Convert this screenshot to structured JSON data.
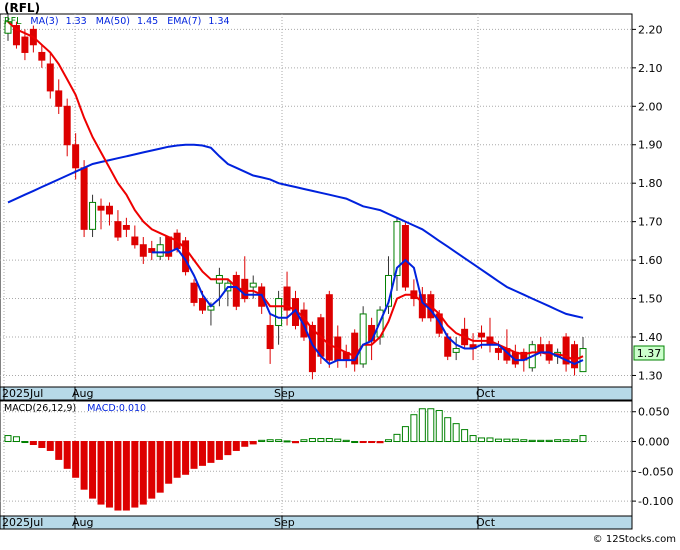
{
  "header": {
    "title": "(RFL)"
  },
  "main_chart": {
    "legend": {
      "ticker": "RFL",
      "ma3_label": "MA(3)",
      "ma3_value": "1.33",
      "ma50_label": "MA(50)",
      "ma50_value": "1.45",
      "ema7_label": "EMA(7)",
      "ema7_value": "1.34"
    },
    "y_ticks": [
      "2.20",
      "2.10",
      "2.00",
      "1.90",
      "1.80",
      "1.70",
      "1.60",
      "1.50",
      "1.40",
      "1.30"
    ],
    "last_price": "1.37"
  },
  "time_axis": {
    "labels": [
      "2025Jul",
      "Aug",
      "Sep",
      "Oct"
    ]
  },
  "macd_chart": {
    "legend": {
      "label": "MACD(26,12,9)",
      "macd_label": "MACD:",
      "macd_value": "0.010"
    },
    "y_ticks": [
      "0.050",
      "0.000",
      "-0.050",
      "-0.100"
    ]
  },
  "footer": {
    "credit": "© 12Stocks.com"
  },
  "colors": {
    "up": "#008000",
    "down": "#dd0000",
    "ma": "#0022dd",
    "ema": "#ee0000",
    "axis_band": "#b7d9e8"
  },
  "chart_data": [
    {
      "type": "candlestick",
      "title": "(RFL)",
      "ylim": [
        1.27,
        2.24
      ],
      "y_ticks": [
        2.2,
        2.1,
        2.0,
        1.9,
        1.8,
        1.7,
        1.6,
        1.5,
        1.4,
        1.3
      ],
      "x_labels": [
        "2025Jul",
        "Aug",
        "Sep",
        "Oct"
      ],
      "ohlc": [
        [
          2.19,
          2.24,
          2.17,
          2.22
        ],
        [
          2.21,
          2.22,
          2.15,
          2.16
        ],
        [
          2.18,
          2.2,
          2.12,
          2.14
        ],
        [
          2.2,
          2.21,
          2.14,
          2.16
        ],
        [
          2.14,
          2.16,
          2.1,
          2.12
        ],
        [
          2.11,
          2.14,
          2.02,
          2.04
        ],
        [
          2.04,
          2.07,
          1.98,
          2.0
        ],
        [
          2.0,
          2.02,
          1.87,
          1.9
        ],
        [
          1.9,
          1.93,
          1.81,
          1.84
        ],
        [
          1.84,
          1.86,
          1.66,
          1.68
        ],
        [
          1.68,
          1.77,
          1.66,
          1.75
        ],
        [
          1.74,
          1.76,
          1.68,
          1.73
        ],
        [
          1.74,
          1.75,
          1.69,
          1.72
        ],
        [
          1.7,
          1.73,
          1.65,
          1.66
        ],
        [
          1.69,
          1.71,
          1.66,
          1.68
        ],
        [
          1.66,
          1.69,
          1.63,
          1.64
        ],
        [
          1.64,
          1.66,
          1.59,
          1.61
        ],
        [
          1.63,
          1.65,
          1.6,
          1.62
        ],
        [
          1.61,
          1.66,
          1.6,
          1.64
        ],
        [
          1.66,
          1.66,
          1.6,
          1.61
        ],
        [
          1.67,
          1.68,
          1.62,
          1.63
        ],
        [
          1.65,
          1.66,
          1.56,
          1.57
        ],
        [
          1.54,
          1.55,
          1.48,
          1.49
        ],
        [
          1.5,
          1.52,
          1.46,
          1.47
        ],
        [
          1.47,
          1.49,
          1.43,
          1.48
        ],
        [
          1.54,
          1.58,
          1.48,
          1.56
        ],
        [
          1.52,
          1.55,
          1.48,
          1.54
        ],
        [
          1.56,
          1.57,
          1.47,
          1.48
        ],
        [
          1.55,
          1.61,
          1.49,
          1.5
        ],
        [
          1.53,
          1.56,
          1.5,
          1.54
        ],
        [
          1.53,
          1.54,
          1.46,
          1.48
        ],
        [
          1.43,
          1.46,
          1.33,
          1.37
        ],
        [
          1.43,
          1.52,
          1.38,
          1.5
        ],
        [
          1.53,
          1.57,
          1.43,
          1.47
        ],
        [
          1.5,
          1.52,
          1.42,
          1.43
        ],
        [
          1.47,
          1.49,
          1.39,
          1.4
        ],
        [
          1.43,
          1.44,
          1.29,
          1.31
        ],
        [
          1.45,
          1.46,
          1.33,
          1.35
        ],
        [
          1.51,
          1.52,
          1.32,
          1.34
        ],
        [
          1.4,
          1.43,
          1.32,
          1.34
        ],
        [
          1.36,
          1.38,
          1.32,
          1.34
        ],
        [
          1.41,
          1.42,
          1.31,
          1.33
        ],
        [
          1.33,
          1.48,
          1.32,
          1.46
        ],
        [
          1.43,
          1.45,
          1.34,
          1.39
        ],
        [
          1.4,
          1.48,
          1.38,
          1.47
        ],
        [
          1.48,
          1.61,
          1.46,
          1.56
        ],
        [
          1.56,
          1.71,
          1.52,
          1.7
        ],
        [
          1.69,
          1.7,
          1.52,
          1.53
        ],
        [
          1.52,
          1.55,
          1.48,
          1.5
        ],
        [
          1.51,
          1.53,
          1.44,
          1.45
        ],
        [
          1.51,
          1.52,
          1.44,
          1.45
        ],
        [
          1.46,
          1.47,
          1.4,
          1.41
        ],
        [
          1.4,
          1.41,
          1.34,
          1.35
        ],
        [
          1.36,
          1.4,
          1.34,
          1.37
        ],
        [
          1.42,
          1.45,
          1.37,
          1.38
        ],
        [
          1.38,
          1.41,
          1.34,
          1.37
        ],
        [
          1.41,
          1.43,
          1.37,
          1.4
        ],
        [
          1.4,
          1.45,
          1.36,
          1.38
        ],
        [
          1.37,
          1.39,
          1.34,
          1.36
        ],
        [
          1.37,
          1.42,
          1.33,
          1.34
        ],
        [
          1.36,
          1.38,
          1.32,
          1.33
        ],
        [
          1.36,
          1.37,
          1.31,
          1.34
        ],
        [
          1.32,
          1.39,
          1.31,
          1.38
        ],
        [
          1.38,
          1.4,
          1.35,
          1.36
        ],
        [
          1.38,
          1.39,
          1.33,
          1.34
        ],
        [
          1.35,
          1.37,
          1.33,
          1.36
        ],
        [
          1.4,
          1.41,
          1.31,
          1.33
        ],
        [
          1.38,
          1.39,
          1.3,
          1.32
        ],
        [
          1.31,
          1.4,
          1.31,
          1.37
        ]
      ],
      "series": [
        {
          "name": "MA(3)",
          "values": [
            2.2,
            2.19,
            2.17,
            2.15,
            2.14,
            2.11,
            2.05,
            1.98,
            1.91,
            1.81,
            1.76,
            1.72,
            1.73,
            1.7,
            1.69,
            1.66,
            1.64,
            1.62,
            1.62,
            1.62,
            1.63,
            1.6,
            1.56,
            1.51,
            1.48,
            1.5,
            1.53,
            1.53,
            1.51,
            1.51,
            1.51,
            1.46,
            1.45,
            1.45,
            1.47,
            1.43,
            1.38,
            1.35,
            1.33,
            1.34,
            1.34,
            1.34,
            1.38,
            1.39,
            1.44,
            1.49,
            1.58,
            1.6,
            1.58,
            1.49,
            1.47,
            1.44,
            1.4,
            1.38,
            1.37,
            1.37,
            1.38,
            1.38,
            1.38,
            1.36,
            1.34,
            1.34,
            1.35,
            1.36,
            1.36,
            1.35,
            1.34,
            1.33,
            1.34
          ]
        },
        {
          "name": "MA(50)",
          "values": [
            1.75,
            1.76,
            1.77,
            1.78,
            1.79,
            1.8,
            1.81,
            1.82,
            1.83,
            1.84,
            1.85,
            1.855,
            1.86,
            1.865,
            1.87,
            1.875,
            1.88,
            1.885,
            1.89,
            1.895,
            1.898,
            1.9,
            1.9,
            1.898,
            1.892,
            1.87,
            1.85,
            1.84,
            1.83,
            1.82,
            1.815,
            1.81,
            1.8,
            1.795,
            1.79,
            1.785,
            1.78,
            1.775,
            1.77,
            1.765,
            1.76,
            1.75,
            1.74,
            1.735,
            1.73,
            1.72,
            1.71,
            1.7,
            1.69,
            1.68,
            1.665,
            1.65,
            1.635,
            1.62,
            1.605,
            1.59,
            1.575,
            1.56,
            1.545,
            1.53,
            1.52,
            1.51,
            1.5,
            1.49,
            1.48,
            1.47,
            1.46,
            1.455,
            1.45
          ]
        },
        {
          "name": "EMA(7)",
          "values": [
            2.22,
            2.2,
            2.19,
            2.18,
            2.16,
            2.14,
            2.11,
            2.07,
            2.03,
            1.97,
            1.92,
            1.88,
            1.84,
            1.8,
            1.77,
            1.73,
            1.7,
            1.68,
            1.67,
            1.66,
            1.65,
            1.63,
            1.6,
            1.57,
            1.55,
            1.55,
            1.55,
            1.53,
            1.52,
            1.52,
            1.51,
            1.48,
            1.48,
            1.48,
            1.47,
            1.45,
            1.42,
            1.4,
            1.38,
            1.37,
            1.36,
            1.35,
            1.38,
            1.38,
            1.4,
            1.44,
            1.5,
            1.51,
            1.51,
            1.49,
            1.48,
            1.46,
            1.43,
            1.41,
            1.4,
            1.39,
            1.39,
            1.39,
            1.38,
            1.37,
            1.36,
            1.355,
            1.36,
            1.36,
            1.355,
            1.355,
            1.35,
            1.34,
            1.35
          ]
        }
      ]
    },
    {
      "type": "bar",
      "title": "MACD(26,12,9)",
      "ylim": [
        -0.125,
        0.068
      ],
      "y_ticks": [
        0.05,
        0.0,
        -0.05,
        -0.1
      ],
      "x_labels": [
        "2025Jul",
        "Aug",
        "Sep",
        "Oct"
      ],
      "series": [
        {
          "name": "MACD",
          "values": [
            0.01,
            0.008,
            0.0,
            -0.005,
            -0.01,
            -0.015,
            -0.03,
            -0.045,
            -0.06,
            -0.08,
            -0.095,
            -0.105,
            -0.11,
            -0.115,
            -0.115,
            -0.11,
            -0.105,
            -0.095,
            -0.085,
            -0.07,
            -0.06,
            -0.055,
            -0.045,
            -0.04,
            -0.035,
            -0.03,
            -0.022,
            -0.015,
            -0.008,
            -0.004,
            0.002,
            0.003,
            0.003,
            0.001,
            -0.002,
            0.003,
            0.005,
            0.005,
            0.005,
            0.004,
            0.002,
            0.0,
            -0.001,
            -0.001,
            -0.002,
            0.003,
            0.012,
            0.025,
            0.045,
            0.055,
            0.055,
            0.052,
            0.04,
            0.03,
            0.02,
            0.01,
            0.006,
            0.006,
            0.004,
            0.004,
            0.004,
            0.003,
            0.002,
            0.002,
            0.002,
            0.003,
            0.003,
            0.003,
            0.01
          ]
        }
      ]
    }
  ]
}
